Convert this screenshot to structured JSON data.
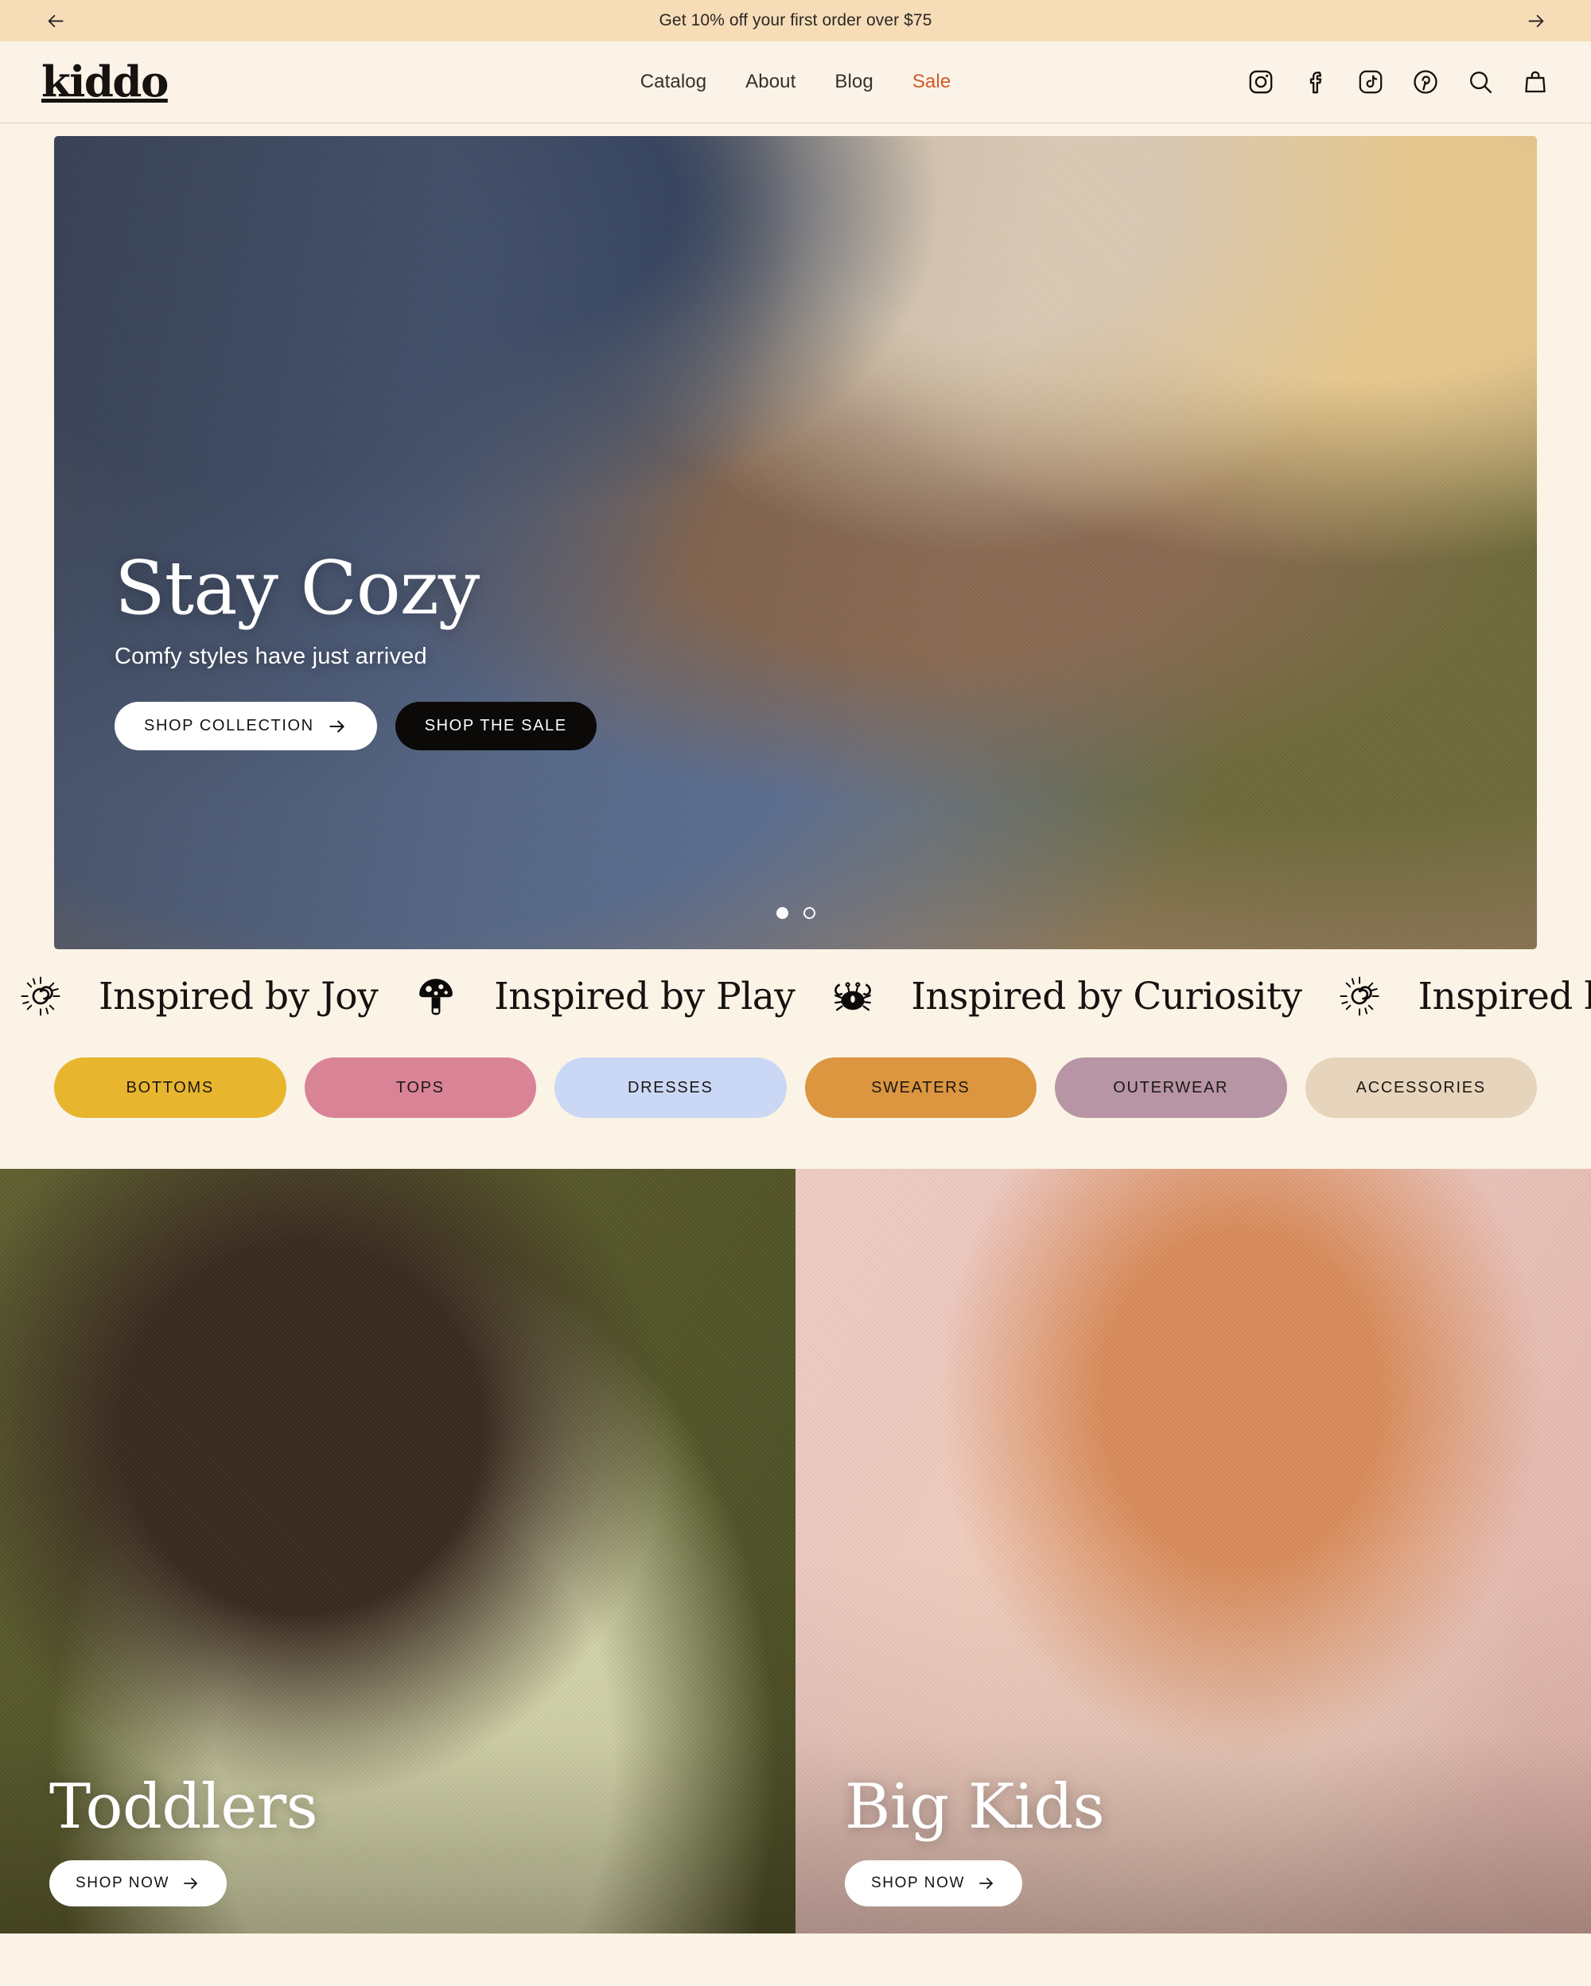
{
  "announcement": {
    "text": "Get 10% off your first order over $75",
    "prev_icon": "arrow-left-icon",
    "next_icon": "arrow-right-icon",
    "background": "#F6DDB8"
  },
  "header": {
    "logo": "kiddo",
    "nav": [
      {
        "label": "Catalog",
        "accent": false
      },
      {
        "label": "About",
        "accent": false
      },
      {
        "label": "Blog",
        "accent": false
      },
      {
        "label": "Sale",
        "accent": true
      }
    ],
    "sale_color": "#D4582A",
    "icons": [
      "instagram-icon",
      "facebook-icon",
      "tiktok-icon",
      "pinterest-icon",
      "search-icon",
      "shopping-bag-icon"
    ]
  },
  "hero": {
    "title": "Stay Cozy",
    "subtitle": "Comfy styles have just arrived",
    "primary_cta": "SHOP COLLECTION",
    "secondary_cta": "SHOP THE SALE",
    "slides": 2,
    "active_slide": 1
  },
  "marquee": {
    "items": [
      {
        "icon": "sun-spiral-icon",
        "label": "Inspired by Joy"
      },
      {
        "icon": "mushroom-icon",
        "label": "Inspired by Play"
      },
      {
        "icon": "crab-icon",
        "label": "Inspired by Curiosity"
      },
      {
        "icon": "sun-spiral-icon",
        "label": "Inspired by Joy"
      },
      {
        "icon": "mushroom-icon",
        "label": ""
      }
    ]
  },
  "categories": [
    {
      "label": "BOTTOMS",
      "color": "#E8B52E"
    },
    {
      "label": "TOPS",
      "color": "#D98396"
    },
    {
      "label": "DRESSES",
      "color": "#CBD8F5"
    },
    {
      "label": "SWEATERS",
      "color": "#DB963F"
    },
    {
      "label": "OUTERWEAR",
      "color": "#B795A4"
    },
    {
      "label": "ACCESSORIES",
      "color": "#E6D5BC"
    }
  ],
  "collections": [
    {
      "title": "Toddlers",
      "cta": "SHOP NOW"
    },
    {
      "title": "Big Kids",
      "cta": "SHOP NOW"
    }
  ]
}
